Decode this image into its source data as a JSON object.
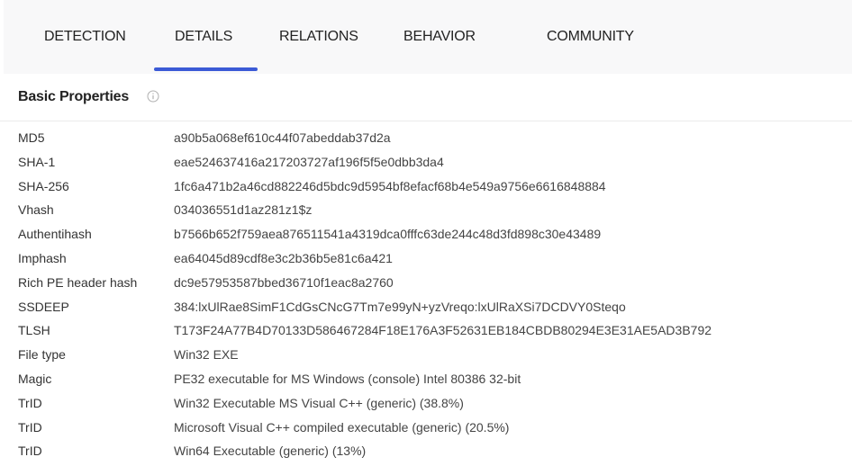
{
  "tabs": [
    {
      "label": "DETECTION"
    },
    {
      "label": "DETAILS",
      "active": true
    },
    {
      "label": "RELATIONS"
    },
    {
      "label": "BEHAVIOR"
    },
    {
      "label": "COMMUNITY"
    }
  ],
  "section": {
    "title": "Basic Properties",
    "info_icon": "info-circle-icon"
  },
  "properties": [
    {
      "label": "MD5",
      "value": "a90b5a068ef610c44f07abeddab37d2a"
    },
    {
      "label": "SHA-1",
      "value": "eae524637416a217203727af196f5f5e0dbb3da4"
    },
    {
      "label": "SHA-256",
      "value": "1fc6a471b2a46cd882246d5bdc9d5954bf8efacf68b4e549a9756e6616848884"
    },
    {
      "label": "Vhash",
      "value": "034036551d1az281z1$z"
    },
    {
      "label": "Authentihash",
      "value": "b7566b652f759aea876511541a4319dca0fffc63de244c48d3fd898c30e43489"
    },
    {
      "label": "Imphash",
      "value": "ea64045d89cdf8e3c2b36b5e81c6a421"
    },
    {
      "label": "Rich PE header hash",
      "value": "dc9e57953587bbed36710f1eac8a2760"
    },
    {
      "label": "SSDEEP",
      "value": "384:lxUlRae8SimF1CdGsCNcG7Tm7e99yN+yzVreqo:lxUlRaXSi7DCDVY0Steqo"
    },
    {
      "label": "TLSH",
      "value": "T173F24A77B4D70133D586467284F18E176A3F52631EB184CBDB80294E3E31AE5AD3B792"
    },
    {
      "label": "File type",
      "value": "Win32 EXE"
    },
    {
      "label": "Magic",
      "value": "PE32 executable for MS Windows (console) Intel 80386 32-bit"
    },
    {
      "label": "TrID",
      "value": "Win32 Executable MS Visual C++ (generic) (38.8%)"
    },
    {
      "label": "TrID",
      "value": "Microsoft Visual C++ compiled executable (generic) (20.5%)"
    },
    {
      "label": "TrID",
      "value": "Win64 Executable (generic) (13%)"
    }
  ],
  "colors": {
    "accent": "#3b5ad6",
    "tabbar_bg": "#f8f8f9"
  }
}
